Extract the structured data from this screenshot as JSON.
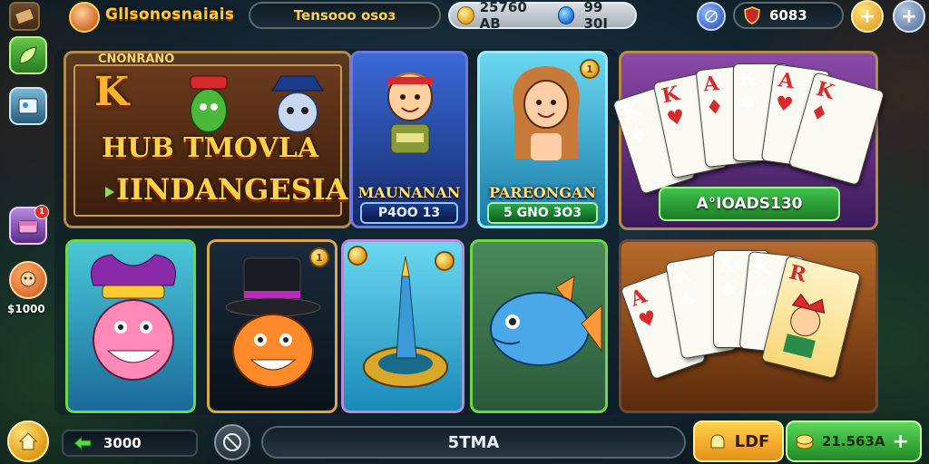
{
  "topbar": {
    "logo_text": "Gllsonosnaiais",
    "status_text": "Tensooo osoз",
    "coins": "25760 AB",
    "gems": "99 30I",
    "shield_value": "6083",
    "add_symbol": "+",
    "plus_symbol": "+"
  },
  "sidebar": {
    "notif_count": "1",
    "balance": "$1000"
  },
  "featured": {
    "small_title": "CNONRANO",
    "big_letter": "K",
    "title_line1": "HUB TMOVLA",
    "title_line2": "IINDANGESIA"
  },
  "characters": [
    {
      "name": "MAUNANAN",
      "sub": "P4OO 13",
      "accent": "#5b6ad4"
    },
    {
      "name": "PAREONGAN",
      "sub": "5 GNO 3O3",
      "accent": "#4ac4d8",
      "coin": "1"
    }
  ],
  "slots": [
    {
      "name": "jester-fish",
      "coin": ""
    },
    {
      "name": "top-hat-fish",
      "coin": "1"
    },
    {
      "name": "golden-horn",
      "coin": ""
    },
    {
      "name": "blue-fish",
      "coin": ""
    }
  ],
  "poker_top": {
    "button_label": "A°IOADS130",
    "cards": [
      "K",
      "K",
      "A",
      "K",
      "A",
      "K"
    ]
  },
  "poker_bottom": {
    "cards": [
      "A",
      "K",
      "AC",
      "K",
      "R"
    ]
  },
  "bottombar": {
    "balance": "3000",
    "center_label": "5TMA",
    "yellow_label": "LDF",
    "green_value": "21.563A",
    "plus_symbol": "+"
  },
  "colors": {
    "gold": "#ffcc33",
    "green": "#3fc24a",
    "blue_frame": "#5b6ad4",
    "brown_frame": "#b58a4a"
  }
}
